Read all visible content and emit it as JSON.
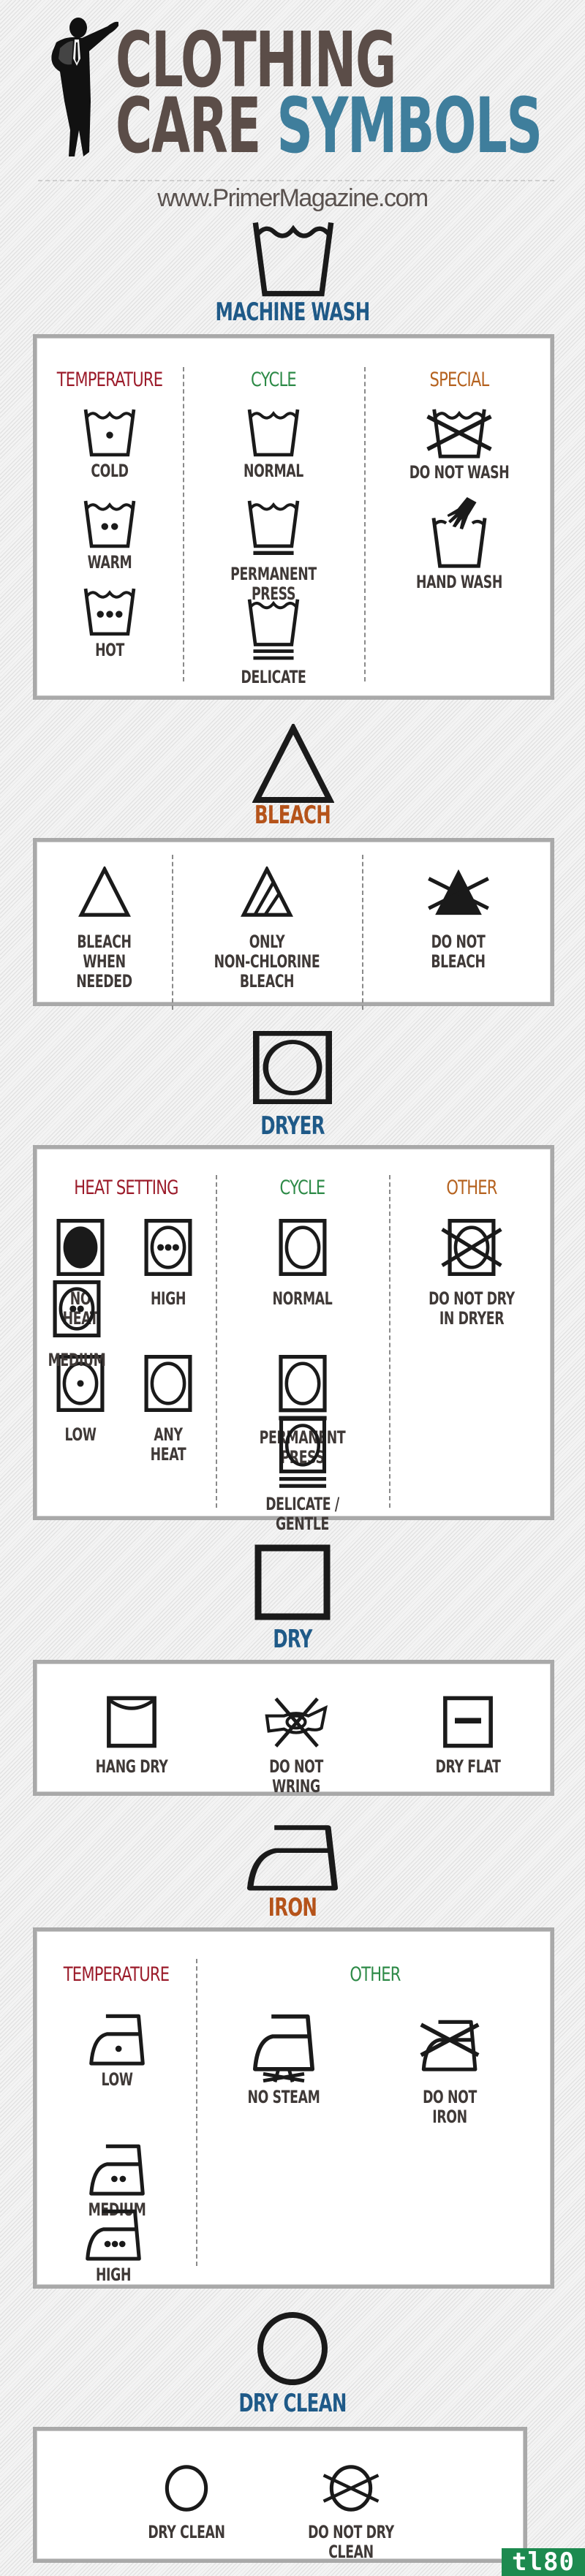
{
  "header": {
    "title_line1": "CLOTHING",
    "title_line2_a": "CARE ",
    "title_line2_b": "SYMBOLS",
    "site": "www.PrimerMagazine.com",
    "logo_icon": "leaning-man-silhouette-icon"
  },
  "colors": {
    "title_brown": "#5b4d48",
    "title_blue": "#3f7e9c",
    "section_blue": "#1f5a88",
    "section_orange": "#b5531a",
    "head_red": "#9b1b2a",
    "head_green": "#2d8a47",
    "head_orange": "#b5621f",
    "watermark_green": "#1d8a4f"
  },
  "sections": {
    "machine_wash": {
      "title": "MACHINE WASH",
      "icon": "washtub-icon",
      "columns": [
        {
          "heading": "TEMPERATURE",
          "items": [
            {
              "label": "COLD",
              "icon": "washtub-one-dot-icon"
            },
            {
              "label": "WARM",
              "icon": "washtub-two-dots-icon"
            },
            {
              "label": "HOT",
              "icon": "washtub-three-dots-icon"
            }
          ]
        },
        {
          "heading": "CYCLE",
          "items": [
            {
              "label": "NORMAL",
              "icon": "washtub-icon"
            },
            {
              "label": "PERMANENT PRESS",
              "icon": "washtub-one-bar-icon"
            },
            {
              "label": "DELICATE",
              "icon": "washtub-two-bars-icon"
            }
          ]
        },
        {
          "heading": "SPECIAL",
          "items": [
            {
              "label": "DO NOT WASH",
              "icon": "washtub-crossed-icon"
            },
            {
              "label": "HAND WASH",
              "icon": "washtub-hand-icon"
            }
          ]
        }
      ]
    },
    "bleach": {
      "title": "BLEACH",
      "icon": "triangle-icon",
      "items": [
        {
          "label": "BLEACH\nWHEN\nNEEDED",
          "icon": "triangle-icon"
        },
        {
          "label": "ONLY\nNON-CHLORINE\nBLEACH",
          "icon": "triangle-striped-icon"
        },
        {
          "label": "DO NOT\nBLEACH",
          "icon": "triangle-filled-crossed-icon"
        }
      ]
    },
    "dryer": {
      "title": "DRYER",
      "icon": "square-circle-icon",
      "columns": [
        {
          "heading": "HEAT SETTING",
          "items": [
            {
              "label": "NO HEAT",
              "icon": "square-filled-circle-icon"
            },
            {
              "label": "HIGH",
              "icon": "square-circle-three-dots-icon"
            },
            {
              "label": "LOW",
              "icon": "square-circle-one-dot-icon"
            },
            {
              "label": "ANY HEAT",
              "icon": "square-circle-icon"
            },
            {
              "label": "MEDIUM",
              "icon": "square-circle-two-dots-icon"
            }
          ]
        },
        {
          "heading": "CYCLE",
          "items": [
            {
              "label": "NORMAL",
              "icon": "square-circle-icon"
            },
            {
              "label": "PERMANENT PRESS",
              "icon": "square-circle-one-bar-icon"
            },
            {
              "label": "DELICATE / GENTLE",
              "icon": "square-circle-two-bars-icon"
            }
          ]
        },
        {
          "heading": "OTHER",
          "items": [
            {
              "label": "DO NOT DRY\nIN DRYER",
              "icon": "square-circle-crossed-icon"
            }
          ]
        }
      ]
    },
    "dry": {
      "title": "DRY",
      "icon": "square-icon",
      "items": [
        {
          "label": "HANG DRY",
          "icon": "square-hang-icon"
        },
        {
          "label": "DO NOT WRING",
          "icon": "wring-crossed-icon"
        },
        {
          "label": "DRY FLAT",
          "icon": "square-bar-icon"
        }
      ]
    },
    "iron": {
      "title": "IRON",
      "icon": "iron-icon",
      "columns": [
        {
          "heading": "TEMPERATURE",
          "items": [
            {
              "label": "LOW",
              "icon": "iron-one-dot-icon"
            },
            {
              "label": "MEDIUM",
              "icon": "iron-two-dots-icon"
            },
            {
              "label": "HIGH",
              "icon": "iron-three-dots-icon"
            }
          ]
        },
        {
          "heading": "OTHER",
          "items": [
            {
              "label": "NO STEAM",
              "icon": "iron-no-steam-icon"
            },
            {
              "label": "DO NOT IRON",
              "icon": "iron-crossed-icon"
            }
          ]
        }
      ]
    },
    "dry_clean": {
      "title": "DRY CLEAN",
      "icon": "circle-icon",
      "items": [
        {
          "label": "DRY CLEAN",
          "icon": "circle-icon"
        },
        {
          "label": "DO NOT DRY CLEAN",
          "icon": "circle-crossed-icon"
        }
      ]
    }
  },
  "watermark": "tl80"
}
